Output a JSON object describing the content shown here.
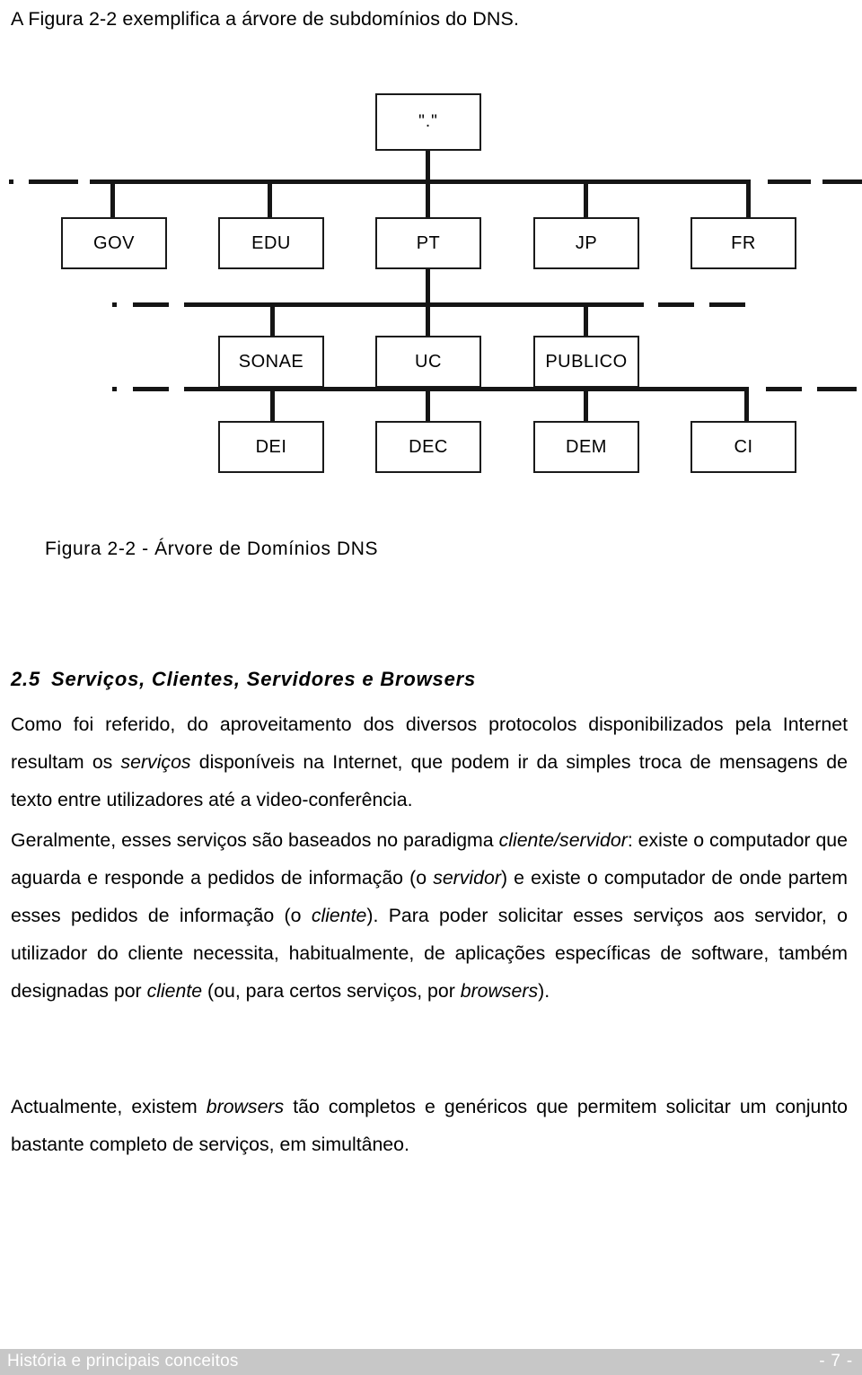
{
  "intro": {
    "text": "A Figura 2-2 exemplifica a árvore de subdomínios do DNS."
  },
  "figure": {
    "caption": "Figura 2-2 - Árvore de Domínios DNS",
    "root_label": "\".\"",
    "level1": [
      "GOV",
      "EDU",
      "PT",
      "JP",
      "FR"
    ],
    "level2": [
      "SONAE",
      "UC",
      "PUBLICO"
    ],
    "level3": [
      "DEI",
      "DEC",
      "DEM",
      "CI"
    ]
  },
  "section": {
    "number": "2.5",
    "title": "Serviços, Clientes, Servidores e Browsers"
  },
  "paragraphs": {
    "p1_a": "Como foi referido, do aproveitamento dos diversos protocolos disponibilizados pela Internet resultam os ",
    "p1_em1": "serviços",
    "p1_b": " disponíveis na Internet, que podem ir da simples troca de mensagens de texto entre utilizadores até a video-conferência.",
    "p2_a": "Geralmente, esses serviços são baseados no paradigma ",
    "p2_em1": "cliente/servidor",
    "p2_b": ": existe o computador que aguarda e responde a pedidos de informação (o ",
    "p2_em2": "servidor",
    "p2_c": ") e existe o computador de onde partem esses pedidos de informação (o ",
    "p2_em3": "cliente",
    "p2_d": "). Para poder solicitar esses serviços aos servidor, o utilizador do cliente necessita, habitualmente, de aplicações específicas de software, também designadas por ",
    "p2_em4": "cliente",
    "p2_e": " (ou, para certos serviços, por ",
    "p2_em5": "browsers",
    "p2_f": ").",
    "p3_a": "Actualmente, existem ",
    "p3_em1": "browsers",
    "p3_b": " tão completos e genéricos que permitem solicitar um conjunto bastante completo de serviços, em simultâneo."
  },
  "footer": {
    "left": "História e principais conceitos",
    "page": "- 7 -"
  }
}
